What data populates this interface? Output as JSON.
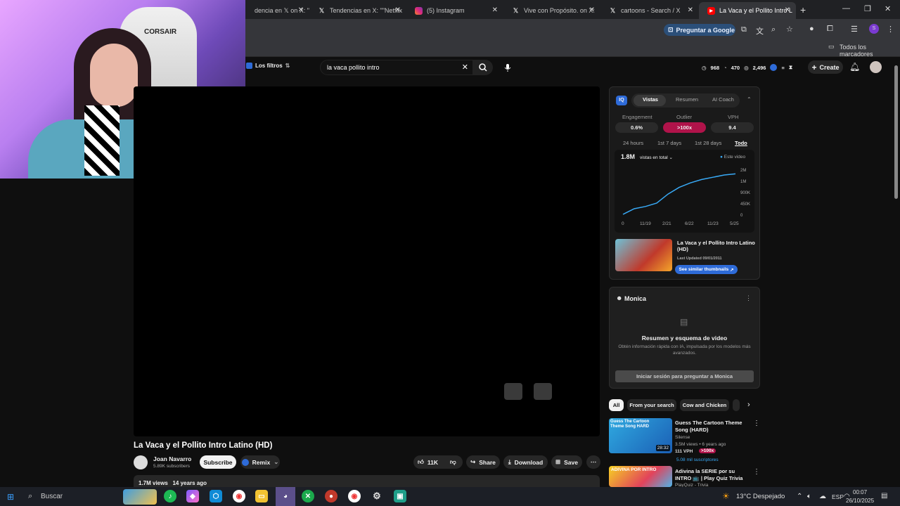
{
  "browser": {
    "tabs": [
      {
        "label": "dencia en 𝕏 on X: \"",
        "icon": "x-logo"
      },
      {
        "label": "Tendencias en X: \"\"Netflix",
        "icon": "x-logo"
      },
      {
        "label": "(5) Instagram",
        "icon": "instagram-logo"
      },
      {
        "label": "Vive con Propósito. on X:",
        "icon": "x-logo"
      },
      {
        "label": "cartoons - Search / X",
        "icon": "x-logo"
      },
      {
        "label": "La Vaca y el Pollito Intro L",
        "icon": "youtube-logo"
      }
    ],
    "ask_google": "Preguntar a Google",
    "bookmarks_all": "Todos los marcadores"
  },
  "youtube": {
    "filters": "Los filtros",
    "search_value": "la vaca pollito intro",
    "stats": {
      "views": "968",
      "likes": "470",
      "subs": "2,496"
    },
    "create": "Create"
  },
  "webcam": {
    "chair_brand": "CORSAIR"
  },
  "video": {
    "title": "La Vaca y el Pollito Intro Latino (HD)",
    "channel": "Joan Navarro",
    "subscribers": "5.89K subscribers",
    "subscribe": "Subscribe",
    "remix": "Remix",
    "likes": "11K",
    "share": "Share",
    "download": "Download",
    "save": "Save",
    "views": "1.7M views",
    "age": "14 years ago"
  },
  "vidiq": {
    "logo": "IQ",
    "tabs": [
      "Vistas",
      "Resumen",
      "AI Coach"
    ],
    "metric_labels": [
      "Engagement",
      "Outlier",
      "VPH"
    ],
    "metric_values": [
      "0.6%",
      ">100x",
      "9.4"
    ],
    "ranges": [
      "24 hours",
      "1st 7 days",
      "1st 28 days",
      "Todo"
    ],
    "total_views": "1.8M",
    "views_dropdown": "vistas en total",
    "legend": "Este video",
    "video_title": "La Vaca y el Pollito Intro Latino (HD)",
    "last_updated": "Last Updated 09/01/2011",
    "similar": "See similar thumbnails"
  },
  "chart_data": {
    "type": "line",
    "x_ticks": [
      "0",
      "11/19",
      "2/21",
      "6/22",
      "11/23",
      "5/25"
    ],
    "y_ticks": [
      "2M",
      "1M",
      "900K",
      "450K",
      "0"
    ],
    "series": [
      {
        "name": "Este video",
        "values": [
          0,
          0.25,
          0.35,
          0.5,
          0.9,
          1.2,
          1.4,
          1.55,
          1.65,
          1.75,
          1.8
        ]
      }
    ]
  },
  "monica": {
    "name": "Monica",
    "heading": "Resumen y esquema de video",
    "desc": "Obtén información rápida con IA, impulsada por los modelos más avanzados.",
    "login": "Iniciar sesión para preguntar a Monica"
  },
  "chips": [
    "All",
    "From your search",
    "Cow and Chicken"
  ],
  "recommendations": [
    {
      "title": "Guess The Cartoon Theme Song (HARD)",
      "channel": "Silense",
      "meta": "3.5M views • 6 years ago",
      "vph": "111 VPH",
      "outlier": ">100x",
      "subs": "5.08 mil suscriptores",
      "duration": "28:32",
      "thumb_text": "Guess The Cartoon Theme Song HARD"
    },
    {
      "title": "Adivina la SERIE por su INTRO 📺 | Play Quiz Trivia",
      "channel": "PlayQuiz - Trivia",
      "thumb_text": "ADIVINA POR INTRO"
    }
  ],
  "taskbar": {
    "search": "Buscar",
    "weather": "13°C  Despejado",
    "lang": "ESP",
    "time": "00:07",
    "date": "26/10/2025"
  }
}
